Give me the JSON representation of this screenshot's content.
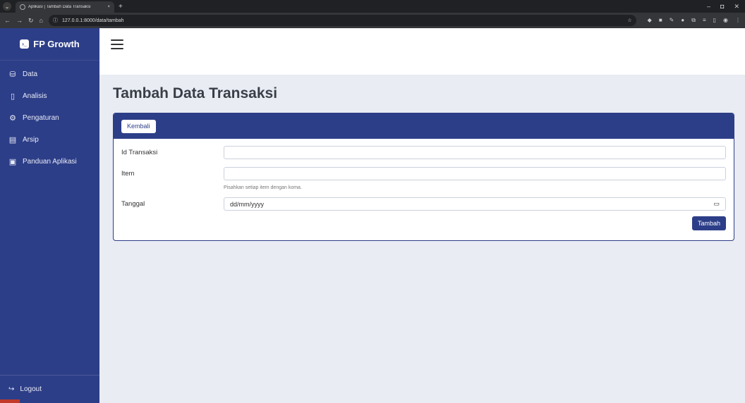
{
  "browser": {
    "tab_title": "Aplikasi | Tambah Data Transaksi",
    "tab_close": "×",
    "new_tab": "+",
    "url": "127.0.0.1:8000/data/tambah",
    "win_min": "–",
    "win_max": "◘",
    "win_close": "✕"
  },
  "sidebar": {
    "brand": "FP Growth",
    "items": [
      {
        "label": "Data",
        "icon": "database-icon"
      },
      {
        "label": "Analisis",
        "icon": "chart-icon"
      },
      {
        "label": "Pengaturan",
        "icon": "gear-icon"
      },
      {
        "label": "Arsip",
        "icon": "archive-icon"
      },
      {
        "label": "Panduan Aplikasi",
        "icon": "book-icon"
      }
    ],
    "logout": "Logout"
  },
  "main": {
    "title": "Tambah Data Transaksi",
    "back_label": "Kembali",
    "form": {
      "id_label": "Id Transaksi",
      "id_value": "",
      "item_label": "Item",
      "item_value": "",
      "item_help": "Pisahkan setiap item dengan koma.",
      "date_label": "Tanggal",
      "date_placeholder": "dd/mm/yyyy",
      "submit_label": "Tambah"
    }
  },
  "colors": {
    "primary": "#2d3e88",
    "background": "#e9ecf3"
  }
}
